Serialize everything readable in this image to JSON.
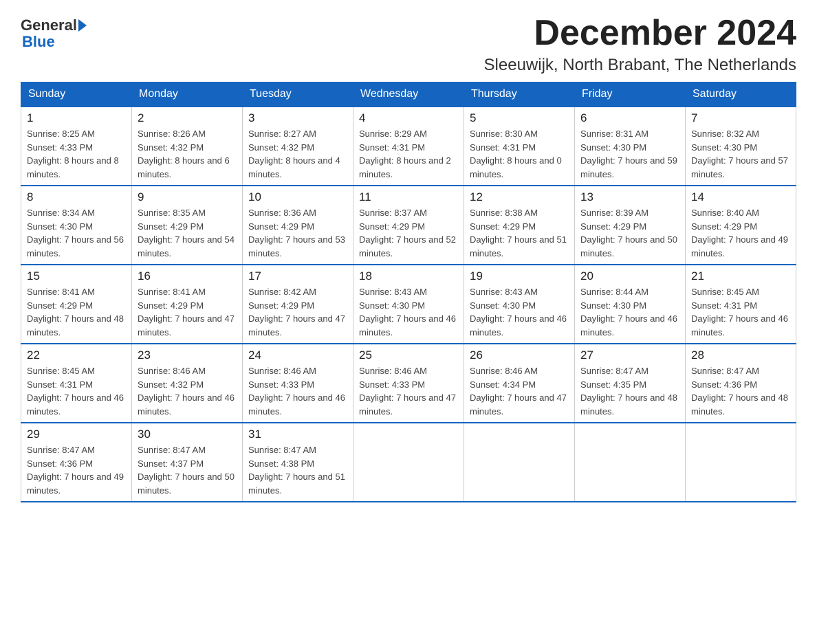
{
  "logo": {
    "text_general": "General",
    "text_blue": "Blue",
    "arrow_color": "#1565C0"
  },
  "header": {
    "month_year": "December 2024",
    "location": "Sleeuwijk, North Brabant, The Netherlands"
  },
  "weekdays": [
    "Sunday",
    "Monday",
    "Tuesday",
    "Wednesday",
    "Thursday",
    "Friday",
    "Saturday"
  ],
  "weeks": [
    [
      {
        "day": "1",
        "sunrise": "Sunrise: 8:25 AM",
        "sunset": "Sunset: 4:33 PM",
        "daylight": "Daylight: 8 hours and 8 minutes."
      },
      {
        "day": "2",
        "sunrise": "Sunrise: 8:26 AM",
        "sunset": "Sunset: 4:32 PM",
        "daylight": "Daylight: 8 hours and 6 minutes."
      },
      {
        "day": "3",
        "sunrise": "Sunrise: 8:27 AM",
        "sunset": "Sunset: 4:32 PM",
        "daylight": "Daylight: 8 hours and 4 minutes."
      },
      {
        "day": "4",
        "sunrise": "Sunrise: 8:29 AM",
        "sunset": "Sunset: 4:31 PM",
        "daylight": "Daylight: 8 hours and 2 minutes."
      },
      {
        "day": "5",
        "sunrise": "Sunrise: 8:30 AM",
        "sunset": "Sunset: 4:31 PM",
        "daylight": "Daylight: 8 hours and 0 minutes."
      },
      {
        "day": "6",
        "sunrise": "Sunrise: 8:31 AM",
        "sunset": "Sunset: 4:30 PM",
        "daylight": "Daylight: 7 hours and 59 minutes."
      },
      {
        "day": "7",
        "sunrise": "Sunrise: 8:32 AM",
        "sunset": "Sunset: 4:30 PM",
        "daylight": "Daylight: 7 hours and 57 minutes."
      }
    ],
    [
      {
        "day": "8",
        "sunrise": "Sunrise: 8:34 AM",
        "sunset": "Sunset: 4:30 PM",
        "daylight": "Daylight: 7 hours and 56 minutes."
      },
      {
        "day": "9",
        "sunrise": "Sunrise: 8:35 AM",
        "sunset": "Sunset: 4:29 PM",
        "daylight": "Daylight: 7 hours and 54 minutes."
      },
      {
        "day": "10",
        "sunrise": "Sunrise: 8:36 AM",
        "sunset": "Sunset: 4:29 PM",
        "daylight": "Daylight: 7 hours and 53 minutes."
      },
      {
        "day": "11",
        "sunrise": "Sunrise: 8:37 AM",
        "sunset": "Sunset: 4:29 PM",
        "daylight": "Daylight: 7 hours and 52 minutes."
      },
      {
        "day": "12",
        "sunrise": "Sunrise: 8:38 AM",
        "sunset": "Sunset: 4:29 PM",
        "daylight": "Daylight: 7 hours and 51 minutes."
      },
      {
        "day": "13",
        "sunrise": "Sunrise: 8:39 AM",
        "sunset": "Sunset: 4:29 PM",
        "daylight": "Daylight: 7 hours and 50 minutes."
      },
      {
        "day": "14",
        "sunrise": "Sunrise: 8:40 AM",
        "sunset": "Sunset: 4:29 PM",
        "daylight": "Daylight: 7 hours and 49 minutes."
      }
    ],
    [
      {
        "day": "15",
        "sunrise": "Sunrise: 8:41 AM",
        "sunset": "Sunset: 4:29 PM",
        "daylight": "Daylight: 7 hours and 48 minutes."
      },
      {
        "day": "16",
        "sunrise": "Sunrise: 8:41 AM",
        "sunset": "Sunset: 4:29 PM",
        "daylight": "Daylight: 7 hours and 47 minutes."
      },
      {
        "day": "17",
        "sunrise": "Sunrise: 8:42 AM",
        "sunset": "Sunset: 4:29 PM",
        "daylight": "Daylight: 7 hours and 47 minutes."
      },
      {
        "day": "18",
        "sunrise": "Sunrise: 8:43 AM",
        "sunset": "Sunset: 4:30 PM",
        "daylight": "Daylight: 7 hours and 46 minutes."
      },
      {
        "day": "19",
        "sunrise": "Sunrise: 8:43 AM",
        "sunset": "Sunset: 4:30 PM",
        "daylight": "Daylight: 7 hours and 46 minutes."
      },
      {
        "day": "20",
        "sunrise": "Sunrise: 8:44 AM",
        "sunset": "Sunset: 4:30 PM",
        "daylight": "Daylight: 7 hours and 46 minutes."
      },
      {
        "day": "21",
        "sunrise": "Sunrise: 8:45 AM",
        "sunset": "Sunset: 4:31 PM",
        "daylight": "Daylight: 7 hours and 46 minutes."
      }
    ],
    [
      {
        "day": "22",
        "sunrise": "Sunrise: 8:45 AM",
        "sunset": "Sunset: 4:31 PM",
        "daylight": "Daylight: 7 hours and 46 minutes."
      },
      {
        "day": "23",
        "sunrise": "Sunrise: 8:46 AM",
        "sunset": "Sunset: 4:32 PM",
        "daylight": "Daylight: 7 hours and 46 minutes."
      },
      {
        "day": "24",
        "sunrise": "Sunrise: 8:46 AM",
        "sunset": "Sunset: 4:33 PM",
        "daylight": "Daylight: 7 hours and 46 minutes."
      },
      {
        "day": "25",
        "sunrise": "Sunrise: 8:46 AM",
        "sunset": "Sunset: 4:33 PM",
        "daylight": "Daylight: 7 hours and 47 minutes."
      },
      {
        "day": "26",
        "sunrise": "Sunrise: 8:46 AM",
        "sunset": "Sunset: 4:34 PM",
        "daylight": "Daylight: 7 hours and 47 minutes."
      },
      {
        "day": "27",
        "sunrise": "Sunrise: 8:47 AM",
        "sunset": "Sunset: 4:35 PM",
        "daylight": "Daylight: 7 hours and 48 minutes."
      },
      {
        "day": "28",
        "sunrise": "Sunrise: 8:47 AM",
        "sunset": "Sunset: 4:36 PM",
        "daylight": "Daylight: 7 hours and 48 minutes."
      }
    ],
    [
      {
        "day": "29",
        "sunrise": "Sunrise: 8:47 AM",
        "sunset": "Sunset: 4:36 PM",
        "daylight": "Daylight: 7 hours and 49 minutes."
      },
      {
        "day": "30",
        "sunrise": "Sunrise: 8:47 AM",
        "sunset": "Sunset: 4:37 PM",
        "daylight": "Daylight: 7 hours and 50 minutes."
      },
      {
        "day": "31",
        "sunrise": "Sunrise: 8:47 AM",
        "sunset": "Sunset: 4:38 PM",
        "daylight": "Daylight: 7 hours and 51 minutes."
      },
      null,
      null,
      null,
      null
    ]
  ]
}
